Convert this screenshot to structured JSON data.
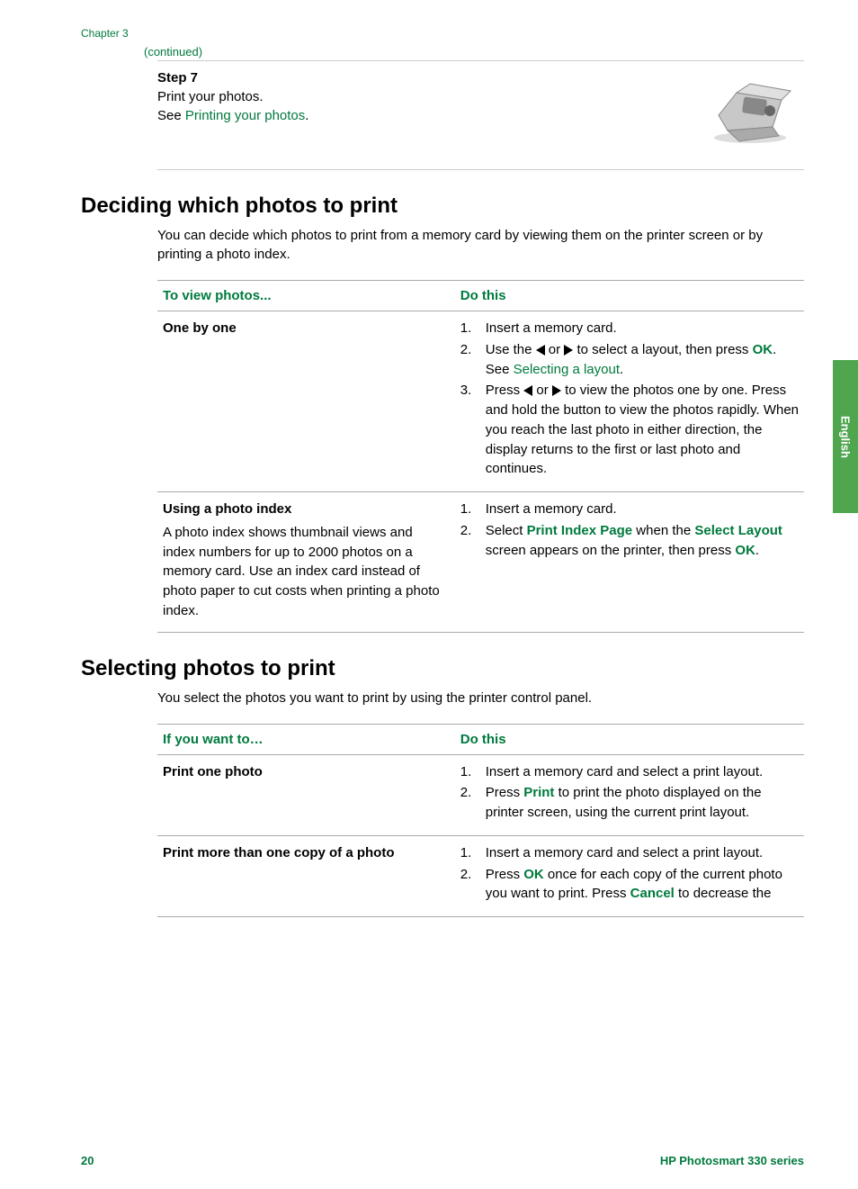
{
  "chapter": "Chapter 3",
  "continued": "(continued)",
  "step": {
    "title": "Step 7",
    "line1": "Print your photos.",
    "see": "See ",
    "link": "Printing your photos",
    "period": "."
  },
  "sideTab": "English",
  "sectionA": {
    "heading": "Deciding which photos to print",
    "intro": "You can decide which photos to print from a memory card by viewing them on the printer screen or by printing a photo index.",
    "th1": "To view photos...",
    "th2": "Do this",
    "r1": {
      "title": "One by one",
      "li1": "Insert a memory card.",
      "li2a": "Use the ",
      "li2b": " or ",
      "li2c": " to select a layout, then press ",
      "li2ok": "OK",
      "li2d": ". See ",
      "li2link": "Selecting a layout",
      "li2e": ".",
      "li3a": "Press ",
      "li3b": " or ",
      "li3c": " to view the photos one by one. Press and hold the button to view the photos rapidly. When you reach the last photo in either direction, the display returns to the first or last photo and continues."
    },
    "r2": {
      "title": "Using a photo index",
      "desc": "A photo index shows thumbnail views and index numbers for up to 2000 photos on a memory card. Use an index card instead of photo paper to cut costs when printing a photo index.",
      "li1": "Insert a memory card.",
      "li2a": "Select ",
      "li2b": "Print Index Page",
      "li2c": " when the ",
      "li2d": "Select Layout",
      "li2e": " screen appears on the printer, then press ",
      "li2ok": "OK",
      "li2f": "."
    }
  },
  "sectionB": {
    "heading": "Selecting photos to print",
    "intro": "You select the photos you want to print by using the printer control panel.",
    "th1": "If you want to…",
    "th2": "Do this",
    "r1": {
      "title": "Print one photo",
      "li1": "Insert a memory card and select a print layout.",
      "li2a": "Press ",
      "li2b": "Print",
      "li2c": " to print the photo displayed on the printer screen, using the current print layout."
    },
    "r2": {
      "title": "Print more than one copy of a photo",
      "li1": "Insert a memory card and select a print layout.",
      "li2a": "Press ",
      "li2ok": "OK",
      "li2b": " once for each copy of the current photo you want to print. Press ",
      "li2cancel": "Cancel",
      "li2c": " to decrease the"
    }
  },
  "footer": {
    "page": "20",
    "product": "HP Photosmart 330 series"
  }
}
